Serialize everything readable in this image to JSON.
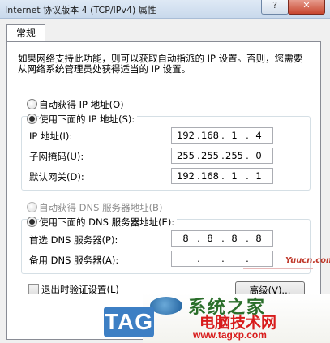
{
  "window": {
    "title": "Internet 协议版本 4 (TCP/IPv4) 属性",
    "help_glyph": "?",
    "close_glyph": "✕"
  },
  "tabs": [
    {
      "label": "常规",
      "active": true
    }
  ],
  "intro_text": "如果网络支持此功能，则可以获取自动指派的 IP 设置。否则，您需要从网络系统管理员处获得适当的 IP 设置。",
  "ip_section": {
    "auto_label": "自动获得 IP 地址(O)",
    "manual_label": "使用下面的 IP 地址(S):",
    "selected": "manual",
    "fields": [
      {
        "label": "IP 地址(I):",
        "octets": [
          "192",
          "168",
          "1",
          "4"
        ]
      },
      {
        "label": "子网掩码(U):",
        "octets": [
          "255",
          "255",
          "255",
          "0"
        ]
      },
      {
        "label": "默认网关(D):",
        "octets": [
          "192",
          "168",
          "1",
          "1"
        ]
      }
    ]
  },
  "dns_section": {
    "auto_label": "自动获得 DNS 服务器地址(B)",
    "manual_label": "使用下面的 DNS 服务器地址(E):",
    "selected": "manual",
    "auto_disabled": true,
    "fields": [
      {
        "label": "首选 DNS 服务器(P):",
        "octets": [
          "8",
          "8",
          "8",
          "8"
        ]
      },
      {
        "label": "备用 DNS 服务器(A):",
        "octets": [
          "",
          "",
          "",
          ""
        ]
      }
    ]
  },
  "validate_on_exit_label": "退出时验证设置(L)",
  "validate_on_exit_checked": false,
  "advanced_button_label": "高级(V)...",
  "watermarks": {
    "yuucn": "Yuucn.com",
    "tag": "TAG",
    "brand": "系统之家",
    "site_cn": "电脑技术网",
    "site_url": "www.tagxp.com"
  }
}
